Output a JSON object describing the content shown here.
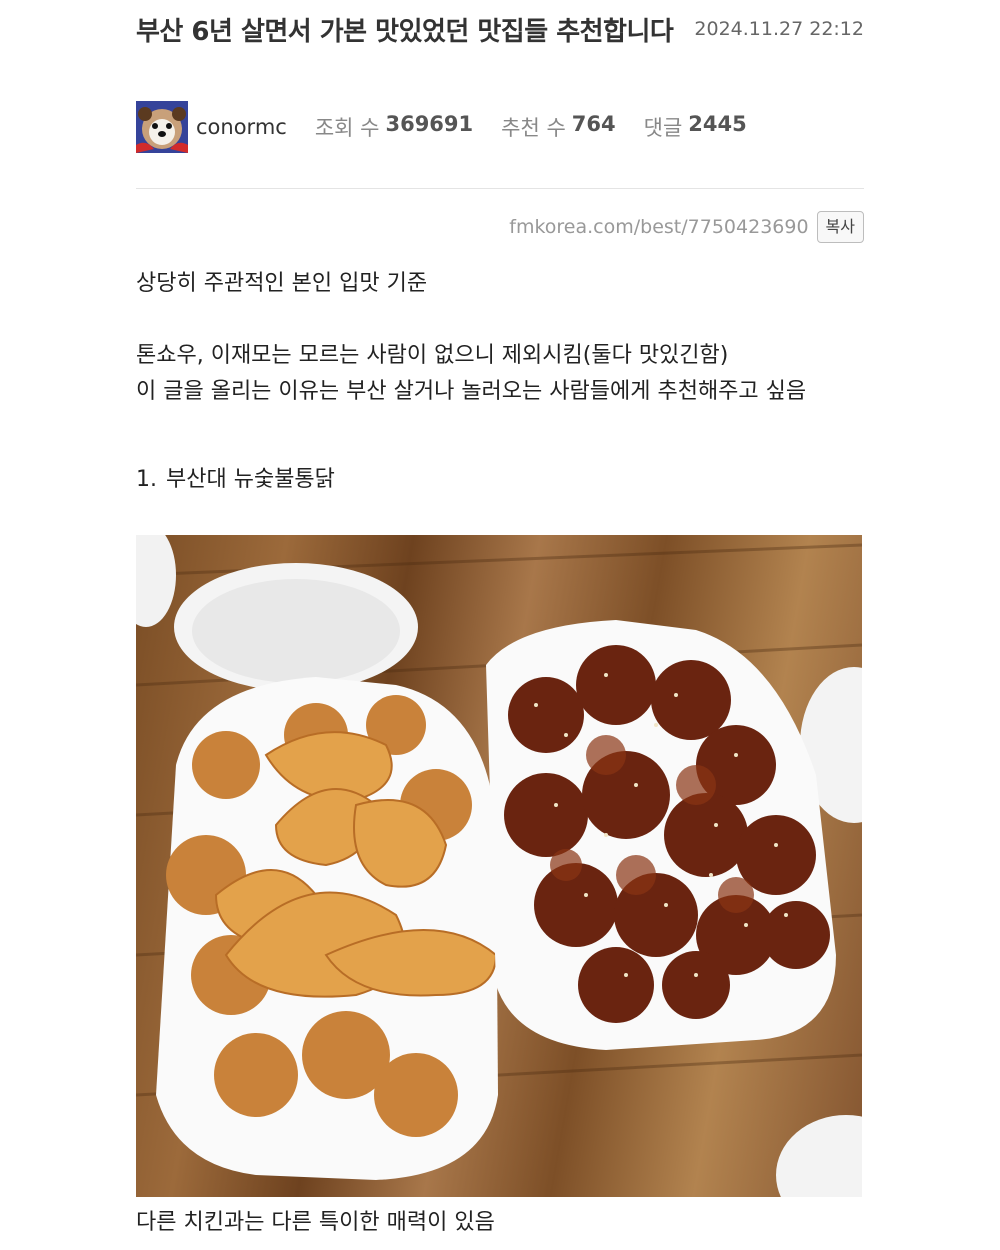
{
  "post": {
    "title": "부산 6년 살면서 가본 맛있었던 맛집들 추천합니다",
    "date": "2024.11.27 22:12",
    "author": "conormc",
    "stats": {
      "views_label": "조회 수",
      "views": "369691",
      "likes_label": "추천 수",
      "likes": "764",
      "comments_label": "댓글",
      "comments": "2445"
    },
    "url": "fmkorea.com/best/7750423690",
    "copy_label": "복사",
    "paragraphs": [
      "상당히 주관적인 본인 입맛 기준",
      "톤쇼우, 이재모는 모르는 사람이 없으니 제외시킴(둘다 맛있긴함)\n이 글을 올리는 이유는 부산 살거나 놀러오는 사람들에게 추천해주고 싶음"
    ],
    "list_item": {
      "number": "1.",
      "text": "부산대 뉴숯불통닭"
    },
    "caption": "다른 치킨과는 다른 특이한 매력이 있음"
  },
  "icons": {
    "avatar": "dog-avatar"
  }
}
